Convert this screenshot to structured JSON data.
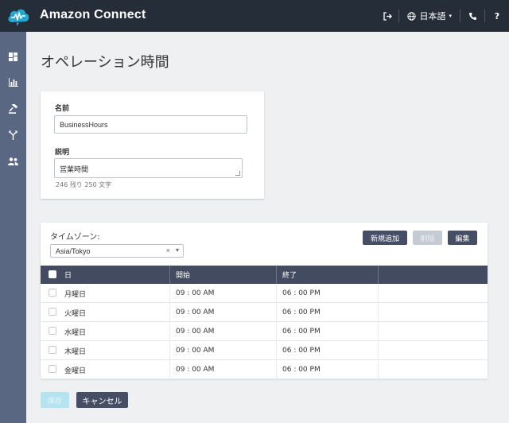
{
  "header": {
    "brand": "Amazon Connect",
    "language": "日本語",
    "help": "?"
  },
  "sidebar": {
    "items": [
      {
        "icon": "dashboard-icon"
      },
      {
        "icon": "metrics-icon"
      },
      {
        "icon": "routing-icon"
      },
      {
        "icon": "flow-icon"
      },
      {
        "icon": "users-icon"
      }
    ]
  },
  "page": {
    "title": "オペレーション時間"
  },
  "form": {
    "name_label": "名前",
    "name_value": "BusinessHours",
    "description_label": "説明",
    "description_value": "営業時間",
    "char_hint": "246 残り 250 文字"
  },
  "schedule": {
    "timezone_label": "タイムゾーン:",
    "timezone_value": "Asia/Tokyo",
    "clear_symbol": "×",
    "add_button": "新規追加",
    "delete_button": "削除",
    "edit_button": "編集",
    "columns": [
      "日",
      "開始",
      "終了",
      ""
    ],
    "rows": [
      {
        "day": "月曜日",
        "start": "09 : 00 AM",
        "end": "06 : 00 PM"
      },
      {
        "day": "火曜日",
        "start": "09 : 00 AM",
        "end": "06 : 00 PM"
      },
      {
        "day": "水曜日",
        "start": "09 : 00 AM",
        "end": "06 : 00 PM"
      },
      {
        "day": "木曜日",
        "start": "09 : 00 AM",
        "end": "06 : 00 PM"
      },
      {
        "day": "金曜日",
        "start": "09 : 00 AM",
        "end": "06 : 00 PM"
      }
    ]
  },
  "footer": {
    "save_button": "保存",
    "cancel_button": "キャンセル"
  },
  "colors": {
    "topbar": "#252d39",
    "sidebar": "#5a6782",
    "accent": "#20a9d2",
    "table_header": "#424b60",
    "button_dark": "#454e64"
  }
}
